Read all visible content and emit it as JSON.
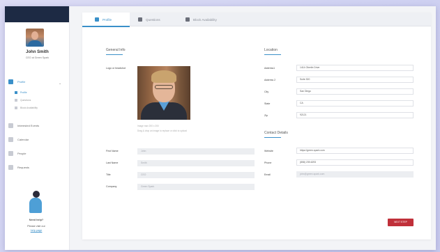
{
  "user": {
    "name": "John Smith",
    "role": "CEO at Green Spark"
  },
  "sidebar": {
    "items": [
      {
        "label": "Profile"
      },
      {
        "label": "Interested Events"
      },
      {
        "label": "Calendar"
      },
      {
        "label": "People"
      },
      {
        "label": "Requests"
      }
    ],
    "subitems": [
      {
        "label": "Profile"
      },
      {
        "label": "Questions"
      },
      {
        "label": "Block Availability"
      }
    ]
  },
  "help": {
    "title": "Need help?",
    "text": "Please visit our",
    "link": "help page"
  },
  "tabs": [
    {
      "label": "Profile"
    },
    {
      "label": "Questions"
    },
    {
      "label": "Block Availability"
    }
  ],
  "general": {
    "title": "General Info",
    "logo_label": "Logo or headshot",
    "img_note1": "Image max 200 x 200",
    "img_note2": "Drag & drop an image to replace or click to upload",
    "fields": [
      {
        "label": "First Name",
        "value": "John"
      },
      {
        "label": "Last Name",
        "value": "Smith"
      },
      {
        "label": "Title",
        "value": "CEO"
      },
      {
        "label": "Company",
        "value": "Green Spark"
      }
    ]
  },
  "location": {
    "title": "Location",
    "fields": [
      {
        "label": "Address1",
        "value": "1414 Oberlin Drive"
      },
      {
        "label": "Address 2",
        "value": "Suite 300"
      },
      {
        "label": "City",
        "value": "San Diego"
      },
      {
        "label": "State",
        "value": "CA"
      },
      {
        "label": "Zip",
        "value": "92121"
      }
    ]
  },
  "contact": {
    "title": "Contact Details",
    "fields": [
      {
        "label": "Website",
        "value": "https://green-spark.com"
      },
      {
        "label": "Phone",
        "value": "(858) 239-6293"
      },
      {
        "label": "Email",
        "value": "john@green-spark.com"
      }
    ]
  },
  "next_button": "NEXT STEP",
  "colors": {
    "accent": "#3a90c9",
    "primary_button": "#c0303a",
    "topbar": "#1d2a44"
  }
}
